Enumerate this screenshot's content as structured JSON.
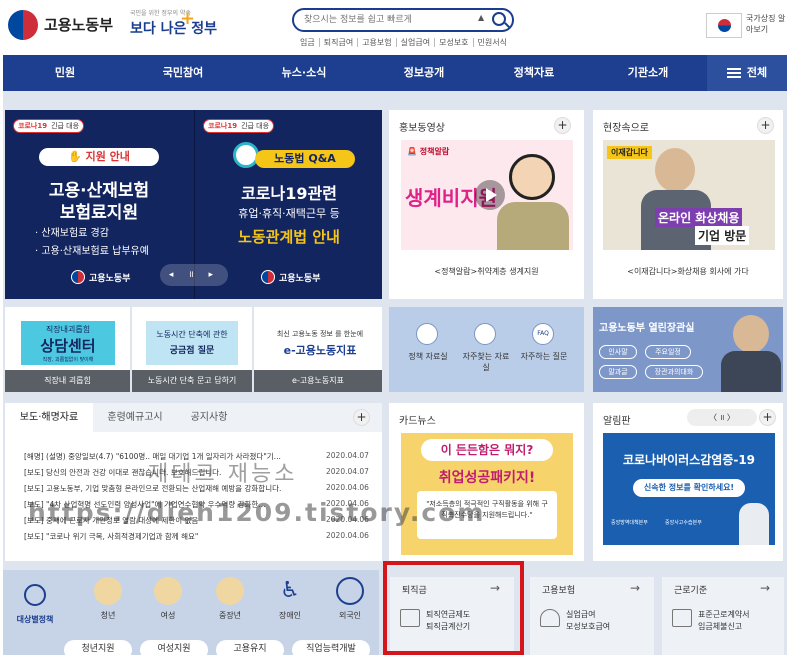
{
  "header": {
    "logo_text": "고용노동부",
    "slogan_small": "국민을 위한 정부의 약속",
    "slogan_main": "보다 나은 정부",
    "search_placeholder": "찾으시는 정보를 쉽고 빠르게",
    "search_arrow": "▲",
    "quick_links": [
      "임금",
      "퇴직급여",
      "고용보험",
      "실업급여",
      "모성보호",
      "민원서식"
    ],
    "gov_label": "국가상징 알아보기"
  },
  "nav": {
    "items": [
      "민원",
      "국민참여",
      "뉴스·소식",
      "정보공개",
      "정책자료",
      "기관소개"
    ],
    "all_label": "전체"
  },
  "banner": {
    "left": {
      "tag": "코로나19",
      "tag_extra": "긴급 대응",
      "pill": "지원 안내",
      "headline1": "고용·산재보험",
      "headline2": "보험료지원",
      "line1": "· 산재보험료 경감",
      "line2": "· 고용·산재보험료 납부유예",
      "org": "고용노동부"
    },
    "right": {
      "tag": "코로나19",
      "tag_extra": "긴급 대응",
      "pill": "노동법 Q&A",
      "headline1": "코로나19관련",
      "line1": "휴업·휴직·재택근무 등",
      "headline2": "노동관계법 안내",
      "org": "고용노동부"
    },
    "controls": "◂ ॥ ▸"
  },
  "promo": {
    "title": "홍보동영상",
    "tag": "정책알람",
    "thumb_text": "생계비지원",
    "caption": "<정책알람>취약계층 생계지원"
  },
  "field": {
    "title": "현장속으로",
    "tag": "이재갑니다",
    "thumb_line1": "온라인 화상채용",
    "thumb_line2": "기업 방문",
    "caption": "<이재갑니다>화상채용 회사에 가다"
  },
  "quick_row": [
    {
      "top_text": "직장내괴롭힘",
      "main_text": "상담센터",
      "sub_text": "직장, 괴롭힘없이 맞이해",
      "label": "직장내 괴롭힘"
    },
    {
      "top_text": "노동시간 단축에 관한",
      "main_text": "궁금점 질문",
      "label": "노동시간 단축 문고 답하기"
    },
    {
      "top_text": "최신 고용노동 정보 를 한눈에",
      "main_text": "e-고용노동지표",
      "label": "e-고용노동지표"
    }
  ],
  "services": [
    {
      "label": "정책 자료실",
      "icon": "book-icon"
    },
    {
      "label": "자주찾는 자료실",
      "icon": "folder-icon"
    },
    {
      "label": "자주하는 질문",
      "icon": "faq-icon"
    }
  ],
  "minister": {
    "title": "고용노동부 열린장관실",
    "buttons": [
      "인사말",
      "주요일정",
      "말과글",
      "장관과의대화"
    ]
  },
  "news": {
    "tabs": [
      "보도·해명자료",
      "훈령예규고시",
      "공지사항"
    ],
    "rows": [
      {
        "title": "[해명] (설명) 중앙일보(4.7) \"6100명.. 매일 대기업 1개 일자리가 사라졌다\"기...",
        "date": "2020.04.07"
      },
      {
        "title": "[보도] 당신의 안전과 건강 이대로 괜찮습니다. 보호해드립니다.",
        "date": "2020.04.07"
      },
      {
        "title": "[보도] 고용노동부, 기업 맞춤형 온라인으로 전환되는 산업재해 예방을 강화합니다.",
        "date": "2020.04.06"
      },
      {
        "title": "[보도] \"4차 산업혁명 선도인력 양성사업\"에 기업연수협약 우수역량 강화한...",
        "date": "2020.04.06"
      },
      {
        "title": "[보도] 중재에 근로자 개인정보 열람 대상에 제한이 없음",
        "date": "2020.04.06"
      },
      {
        "title": "[보도] \"코로나 위기 극복, 사회적경제기업과 함께 해요\"",
        "date": "2020.04.06"
      }
    ]
  },
  "cardnews": {
    "title": "카드뉴스",
    "head1": "이 든든함은 뭐지?",
    "head2": "취업성공패키지!",
    "body": "\"저소득층의 적극적인 구직활동을 위해 구직촉진수당을 지원해드립니다.\""
  },
  "alert": {
    "title": "알림판",
    "controls": "〈 ॥ 〉",
    "headline": "코로나바이러스감염증-19",
    "sub": "신속한 정보를 확인하세요!",
    "org1": "중앙방역대책본부",
    "org2": "중앙사고수습본부"
  },
  "target_policies": {
    "label": "대상별정책",
    "items": [
      "청년",
      "여성",
      "중장년",
      "장애인",
      "외국인"
    ]
  },
  "bottom_quick": [
    {
      "title": "퇴직금",
      "lines": [
        "퇴직연금제도",
        "퇴직금계산기"
      ],
      "arrow": "→"
    },
    {
      "title": "고용보험",
      "lines": [
        "실업급여",
        "모성보호급여"
      ],
      "arrow": "→"
    },
    {
      "title": "근로기준",
      "lines": [
        "표준근로계약서",
        "임금체불신고"
      ],
      "arrow": "→"
    }
  ],
  "bottom_cut": [
    "청년지원",
    "여성지원",
    "고용유지",
    "직업능력개발"
  ],
  "watermark": {
    "line1": "재테크 재능소",
    "line2": "https://dieh1209.tistory.com"
  },
  "colors": {
    "nav_bg": "#1e3f8f",
    "banner_bg": "#13255f",
    "highlight_red": "#d4161c",
    "alert_blue": "#1a5fb0"
  }
}
